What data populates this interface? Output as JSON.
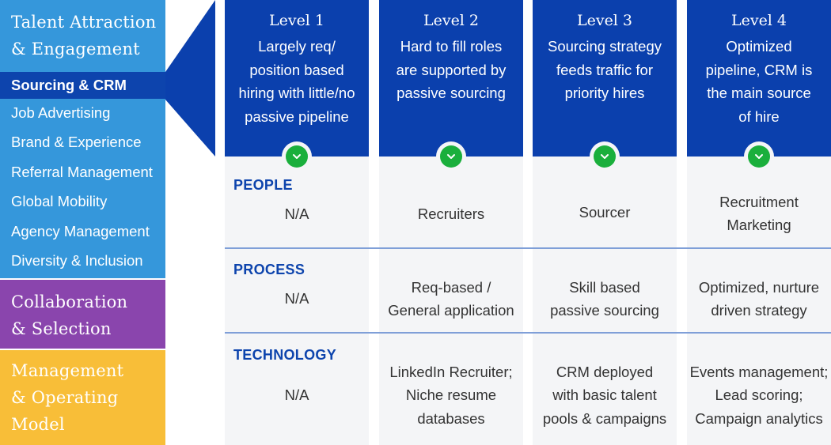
{
  "sidebar": {
    "sections": [
      {
        "title_lines": [
          "Talent Attraction",
          "& Engagement"
        ],
        "color": "#3597db",
        "items": [
          {
            "label": "Sourcing & CRM",
            "active": true
          },
          {
            "label": "Job Advertising",
            "active": false
          },
          {
            "label": "Brand & Experience",
            "active": false
          },
          {
            "label": "Referral Management",
            "active": false
          },
          {
            "label": "Global Mobility",
            "active": false
          },
          {
            "label": "Agency Management",
            "active": false
          },
          {
            "label": "Diversity & Inclusion",
            "active": false
          }
        ]
      },
      {
        "title_lines": [
          "Collaboration",
          "& Selection"
        ],
        "color": "#8a45ad"
      },
      {
        "title_lines": [
          "Management",
          "& Operating",
          "Model"
        ],
        "color": "#f8be38"
      }
    ],
    "active_color": "#0d44ad"
  },
  "rows": [
    "PEOPLE",
    "PROCESS",
    "TECHNOLOGY"
  ],
  "levels": [
    {
      "level": "Level 1",
      "description": [
        "Largely req/",
        "position based",
        "hiring with little/no",
        "passive pipeline"
      ],
      "people": [
        "N/A"
      ],
      "process": [
        "N/A"
      ],
      "technology": [
        "N/A"
      ]
    },
    {
      "level": "Level 2",
      "description": [
        "Hard to fill roles",
        "are supported by",
        "passive sourcing"
      ],
      "people": [
        "Recruiters"
      ],
      "process": [
        "Req-based /",
        "General application"
      ],
      "technology": [
        "LinkedIn Recruiter;",
        "Niche resume",
        "databases"
      ]
    },
    {
      "level": "Level 3",
      "description": [
        "Sourcing strategy",
        "feeds traffic for",
        "priority hires"
      ],
      "people": [
        "Sourcer"
      ],
      "process": [
        "Skill based",
        "passive sourcing"
      ],
      "technology": [
        "CRM deployed",
        "with basic talent",
        "pools & campaigns"
      ]
    },
    {
      "level": "Level 4",
      "description": [
        "Optimized",
        "pipeline, CRM is",
        "the main source",
        "of hire"
      ],
      "people": [
        "Recruitment",
        "Marketing"
      ],
      "process": [
        "Optimized, nurture",
        "driven strategy"
      ],
      "technology": [
        "Events management;",
        "Lead scoring;",
        "Campaign analytics"
      ]
    }
  ],
  "colors": {
    "header_blue": "#0b40ad",
    "check_green": "#1aaf3c",
    "row_label_blue": "#0d44ad",
    "separator": "#7f9fd8",
    "cell_bg": "#f4f5f7"
  },
  "icons": {
    "level_check": "chevron-down-icon"
  }
}
